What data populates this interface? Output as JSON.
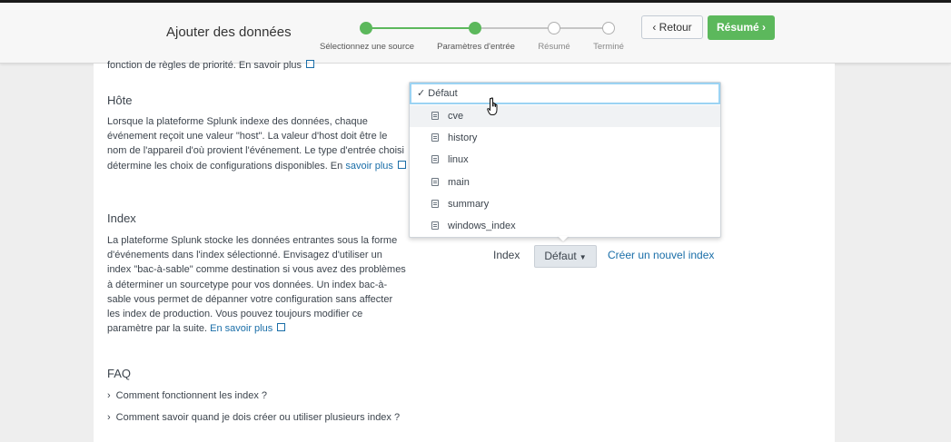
{
  "header": {
    "title": "Ajouter des données",
    "steps": [
      {
        "label": "Sélectionnez une source",
        "state": "done"
      },
      {
        "label": "Paramètres d'entrée",
        "state": "current"
      },
      {
        "label": "Résumé",
        "state": "todo"
      },
      {
        "label": "Terminé",
        "state": "todo"
      }
    ],
    "back_label": "Retour",
    "next_label": "Résumé"
  },
  "colors": {
    "accent_green": "#5cb85c",
    "link_blue": "#1a6ea8",
    "focus_blue": "#9bd3f3"
  },
  "content": {
    "cut_text": "fonction de règles de priorité. En savoir plus",
    "host": {
      "title": "Hôte",
      "description": "Lorsque la plateforme Splunk indexe des données, chaque événement reçoit une valeur \"host\". La valeur d'host doit être le nom de l'appareil d'où provient l'événement. Le type d'entrée choisi détermine les choix de configurations disponibles. En",
      "link": "savoir plus"
    },
    "index": {
      "title": "Index",
      "description": "La plateforme Splunk stocke les données entrantes sous la forme d'événements dans l'index sélectionné. Envisagez d'utiliser un index \"bac-à-sable\" comme destination si vous avez des problèmes à déterminer un sourcetype pour vos données. Un index bac-à-sable vous permet de dépanner votre configuration sans affecter les index de production. Vous pouvez toujours modifier ce paramètre par la suite.",
      "link": "En savoir plus",
      "field_label": "Index",
      "selected": "Défaut",
      "create_link": "Créer un nouvel index"
    },
    "faq": {
      "title": "FAQ",
      "items": [
        "Comment fonctionnent les index ?",
        "Comment savoir quand je dois créer ou utiliser plusieurs index ?"
      ]
    }
  },
  "dropdown": {
    "selected_label": "✓ Défaut",
    "options": [
      "cve",
      "history",
      "linux",
      "main",
      "summary",
      "windows_index"
    ],
    "hovered": "cve"
  }
}
